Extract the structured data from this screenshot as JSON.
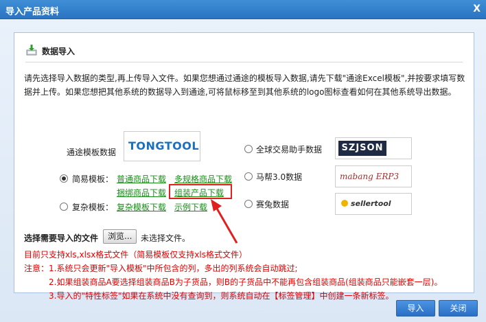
{
  "window": {
    "title": "导入产品资料",
    "close_symbol": "X"
  },
  "section": {
    "title": "数据导入"
  },
  "description": "请先选择导入数据的类型,再上传导入文件。如果您想通过通途的模板导入数据,请先下载\"通途Excel模板\",并按要求填写数据并上传。如果您想把其他系统的数据导入到通途,可将鼠标移至到其他系统的logo图标查看如何在其他系统导出数据。",
  "tongtool": {
    "label": "通途模板数据",
    "logo_text": "TONGTOOL"
  },
  "simple_template": {
    "label": "简易模板：",
    "checked": true,
    "links": [
      "普通商品下载",
      "多规格商品下载",
      "捆绑商品下载",
      "组装产品下载"
    ]
  },
  "complex_template": {
    "label": "复杂模板：",
    "checked": false,
    "links": [
      "复杂模板下载",
      "示例下载"
    ]
  },
  "other_systems": [
    {
      "label": "全球交易助手数据",
      "logo_text": "SZJSON",
      "checked": false
    },
    {
      "label": "马帮3.0数据",
      "logo_text": "mabang ERP3",
      "checked": false
    },
    {
      "label": "赛兔数据",
      "logo_text": "sellertool",
      "checked": false
    }
  ],
  "file_select": {
    "label": "选择需要导入的文件",
    "button": "浏览...",
    "status": "未选择文件。"
  },
  "notes": {
    "support": "目前只支持xls,xlsx格式文件（简易模板仅支持xls格式文件）",
    "prefix": "注意：",
    "items": [
      "1.系统只会更新\"导入模板\"中所包含的列，多出的列系统会自动跳过;",
      "2.如果组装商品A要选择组装商品B为子货品，则B的子货品中不能再包含组装商品(组装商品只能嵌套一层)。",
      "3.导入的\"特性标签\"如果在系统中没有查询到，则系统自动在【标签管理】中创建一条新标签。"
    ]
  },
  "buttons": {
    "import": "导入",
    "close": "关闭"
  },
  "colors": {
    "titlebar": "#2a74c2",
    "link": "#1a8c1a",
    "warning": "#e00000",
    "highlight_border": "#e02020"
  }
}
